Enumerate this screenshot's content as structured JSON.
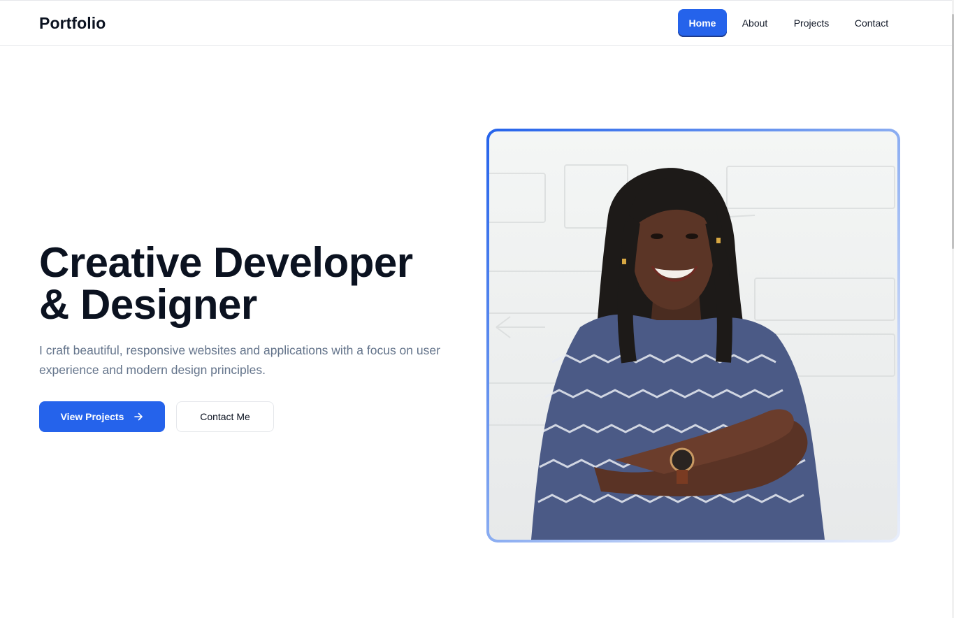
{
  "header": {
    "brand": "Portfolio",
    "nav": [
      {
        "label": "Home",
        "active": true
      },
      {
        "label": "About",
        "active": false
      },
      {
        "label": "Projects",
        "active": false
      },
      {
        "label": "Contact",
        "active": false
      }
    ]
  },
  "hero": {
    "title_line1": "Creative Developer",
    "title_line2": "& Designer",
    "subtitle": "I craft beautiful, responsive websites and applications with a focus on user experience and modern design principles.",
    "primary_button": "View Projects",
    "primary_button_icon": "arrow-right-icon",
    "secondary_button": "Contact Me"
  },
  "colors": {
    "accent": "#2563eb",
    "text": "#0b1220",
    "muted": "#64748b",
    "border": "#e5e7eb"
  },
  "image": {
    "subject": "portrait-photo"
  }
}
